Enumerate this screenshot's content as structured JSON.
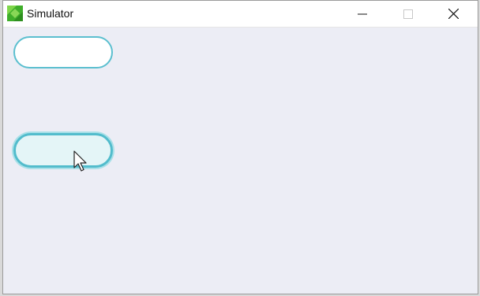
{
  "window": {
    "title": "Simulator",
    "app_icon": "green-leaf-icon",
    "controls": [
      "minimize-icon",
      "maximize-icon",
      "close-icon"
    ]
  },
  "content": {
    "buttons": [
      {
        "label": "",
        "state": "normal"
      },
      {
        "label": "",
        "state": "hover-focused"
      }
    ]
  },
  "colors": {
    "background": "#ecedf5",
    "button_border": "#5bbfcf",
    "button_hover_fill": "#e4f5f7"
  }
}
